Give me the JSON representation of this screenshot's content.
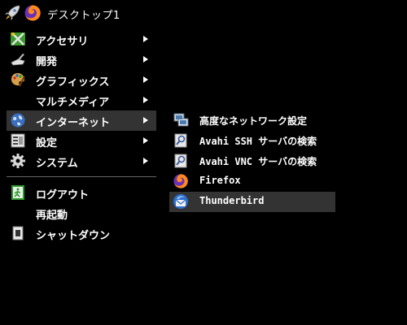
{
  "panel": {
    "title": "デスクトップ1",
    "icons": [
      "rocket-icon",
      "firefox-icon"
    ]
  },
  "menu": {
    "items": [
      {
        "label": "アクセサリ",
        "icon": "accessories-icon",
        "submenu": true
      },
      {
        "label": "開発",
        "icon": "development-icon",
        "submenu": true
      },
      {
        "label": "グラフィックス",
        "icon": "graphics-icon",
        "submenu": true
      },
      {
        "label": "マルチメディア",
        "icon": "",
        "submenu": true
      },
      {
        "label": "インターネット",
        "icon": "globe-icon",
        "submenu": true,
        "active": true
      },
      {
        "label": "設定",
        "icon": "settings-icon",
        "submenu": true
      },
      {
        "label": "システム",
        "icon": "gear-icon",
        "submenu": true
      }
    ],
    "actions": [
      {
        "label": "ログアウト",
        "icon": "logout-icon"
      },
      {
        "label": "再起動",
        "icon": ""
      },
      {
        "label": "シャットダウン",
        "icon": "shutdown-icon"
      }
    ]
  },
  "submenu": {
    "items": [
      {
        "label": "高度なネットワーク設定",
        "icon": "network-icon"
      },
      {
        "label": "Avahi SSH サーバの検索",
        "icon": "avahi-icon"
      },
      {
        "label": "Avahi VNC サーバの検索",
        "icon": "avahi-icon"
      },
      {
        "label": "Firefox",
        "icon": "firefox-icon"
      },
      {
        "label": "Thunderbird",
        "icon": "thunderbird-icon",
        "active": true
      }
    ]
  },
  "colors": {
    "background": "#000000",
    "highlight": "#333333",
    "text": "#ffffff"
  }
}
